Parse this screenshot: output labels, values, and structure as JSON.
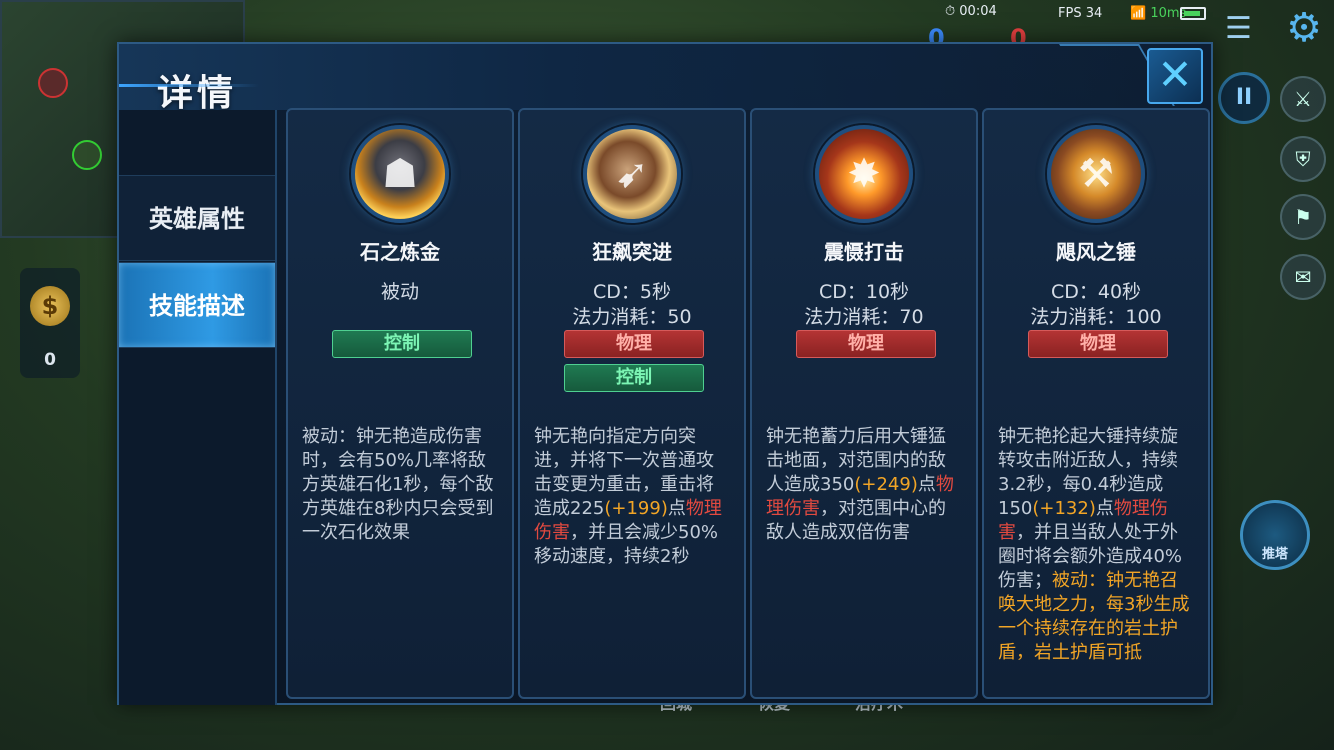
{
  "hud": {
    "time": "00:04",
    "fps": "FPS 34",
    "ping": "10ms",
    "score_blue": "0",
    "score_red": "0",
    "gold": "0",
    "tower_label": "推塔",
    "hint_1": "回城",
    "hint_2": "恢复",
    "hint_3": "治疗术"
  },
  "panel": {
    "title": "详情",
    "close_label": "✕"
  },
  "sidebar": {
    "tabs": [
      {
        "label": "英雄属性",
        "active": false
      },
      {
        "label": "技能描述",
        "active": true
      }
    ]
  },
  "skills": [
    {
      "name": "石之炼金",
      "type": "被动",
      "tags": [
        "控制"
      ],
      "desc": "被动：钟无艳造成伤害时，会有50%几率将敌方英雄石化1秒，每个敌方英雄在8秒内只会受到一次石化效果"
    },
    {
      "name": "狂飙突进",
      "cd": "CD：5秒",
      "mana": "法力消耗：50",
      "tags": [
        "物理",
        "控制"
      ],
      "desc_a": "钟无艳向指定方向突进，并将下一次普通攻击变更为重击，重击将造成225",
      "desc_b": "(+199)",
      "desc_c": "点",
      "desc_d": "物理伤害",
      "desc_e": "，并且会减少50%移动速度，持续2秒"
    },
    {
      "name": "震慑打击",
      "cd": "CD：10秒",
      "mana": "法力消耗：70",
      "tags": [
        "物理"
      ],
      "desc_a": "钟无艳蓄力后用大锤猛击地面，对范围内的敌人造成350",
      "desc_b": "(+249)",
      "desc_c": "点",
      "desc_d": "物理伤害",
      "desc_e": "，对范围中心的敌人造成双倍伤害"
    },
    {
      "name": "飓风之锤",
      "cd": "CD：40秒",
      "mana": "法力消耗：100",
      "tags": [
        "物理"
      ],
      "desc_a": "钟无艳抡起大锤持续旋转攻击附近敌人，持续3.2秒，每0.4秒造成150",
      "desc_b": "(+132)",
      "desc_c": "点",
      "desc_d": "物理伤害",
      "desc_e": "，并且当敌人处于外圈时将会额外造成40%伤害；",
      "desc_f": "被动：钟无艳召唤大地之力，每3秒生成一个持续存在的岩土护盾，岩土护盾可抵"
    }
  ],
  "colors": {
    "accent": "#2f9ae4",
    "tag_control": "#1f7a52",
    "tag_physical": "#b43434",
    "highlight_orange": "#f2a526",
    "highlight_red": "#e24a40"
  }
}
